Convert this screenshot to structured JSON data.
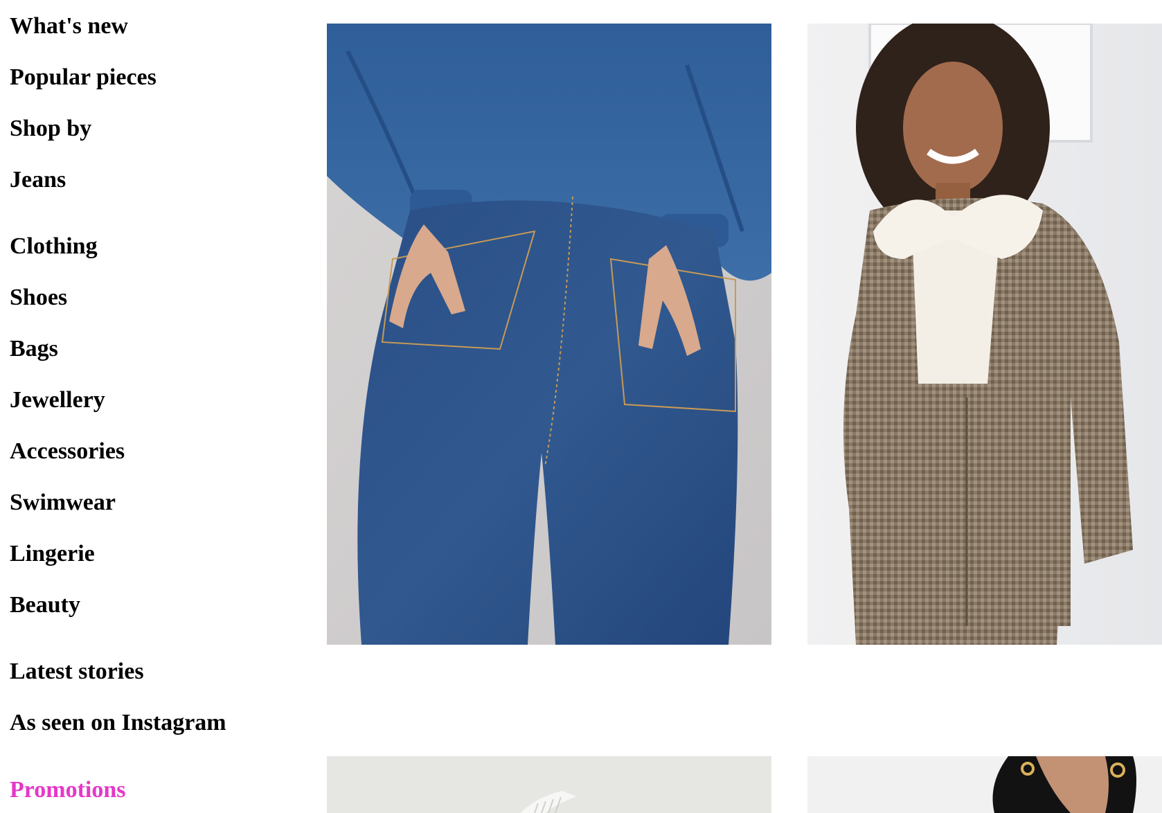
{
  "nav": {
    "items": [
      {
        "label": "What's new"
      },
      {
        "label": "Popular pieces"
      },
      {
        "label": "Shop by"
      },
      {
        "label": "Jeans"
      },
      {
        "label": "Clothing"
      },
      {
        "label": "Shoes"
      },
      {
        "label": "Bags"
      },
      {
        "label": "Jewellery"
      },
      {
        "label": "Accessories"
      },
      {
        "label": "Swimwear"
      },
      {
        "label": "Lingerie"
      },
      {
        "label": "Beauty"
      },
      {
        "label": "Latest stories"
      },
      {
        "label": "As seen on Instagram"
      },
      {
        "label": "Promotions"
      }
    ]
  },
  "colors": {
    "promotions_accent": "#e637c8",
    "text": "#000000",
    "background": "#ffffff"
  }
}
